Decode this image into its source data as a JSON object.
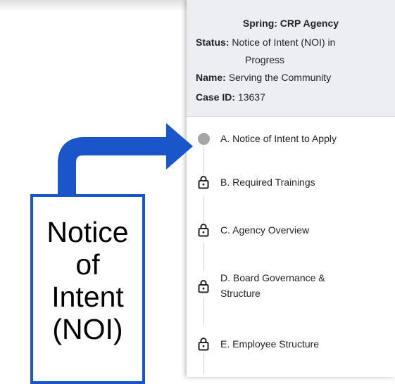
{
  "case_header": {
    "title": "Spring: CRP Agency",
    "status_label": "Status:",
    "status_value": "Notice of Intent (NOI) in",
    "status_value_cont": "Progress",
    "name_label": "Name:",
    "name_value": "Serving the Community",
    "case_id_label": "Case ID:",
    "case_id_value": "13637"
  },
  "steps": [
    {
      "label": "A. Notice of Intent to Apply",
      "state": "current",
      "icon": "circle-dot-icon"
    },
    {
      "label": "B. Required Trainings",
      "state": "locked",
      "icon": "lock-icon"
    },
    {
      "label": "C. Agency Overview",
      "state": "locked",
      "icon": "lock-icon"
    },
    {
      "label": "D. Board Governance &",
      "label_cont": "Structure",
      "state": "locked",
      "icon": "lock-icon"
    },
    {
      "label": "E. Employee Structure",
      "state": "locked",
      "icon": "lock-icon"
    }
  ],
  "callout": {
    "line1": "Notice",
    "line2": "of",
    "line3": "Intent",
    "line4": "(NOI)",
    "color": "#1a56c9"
  },
  "colors": {
    "header_bg": "#eceef4",
    "current_dot": "#a6a6a6",
    "arrow": "#1a56c9"
  }
}
